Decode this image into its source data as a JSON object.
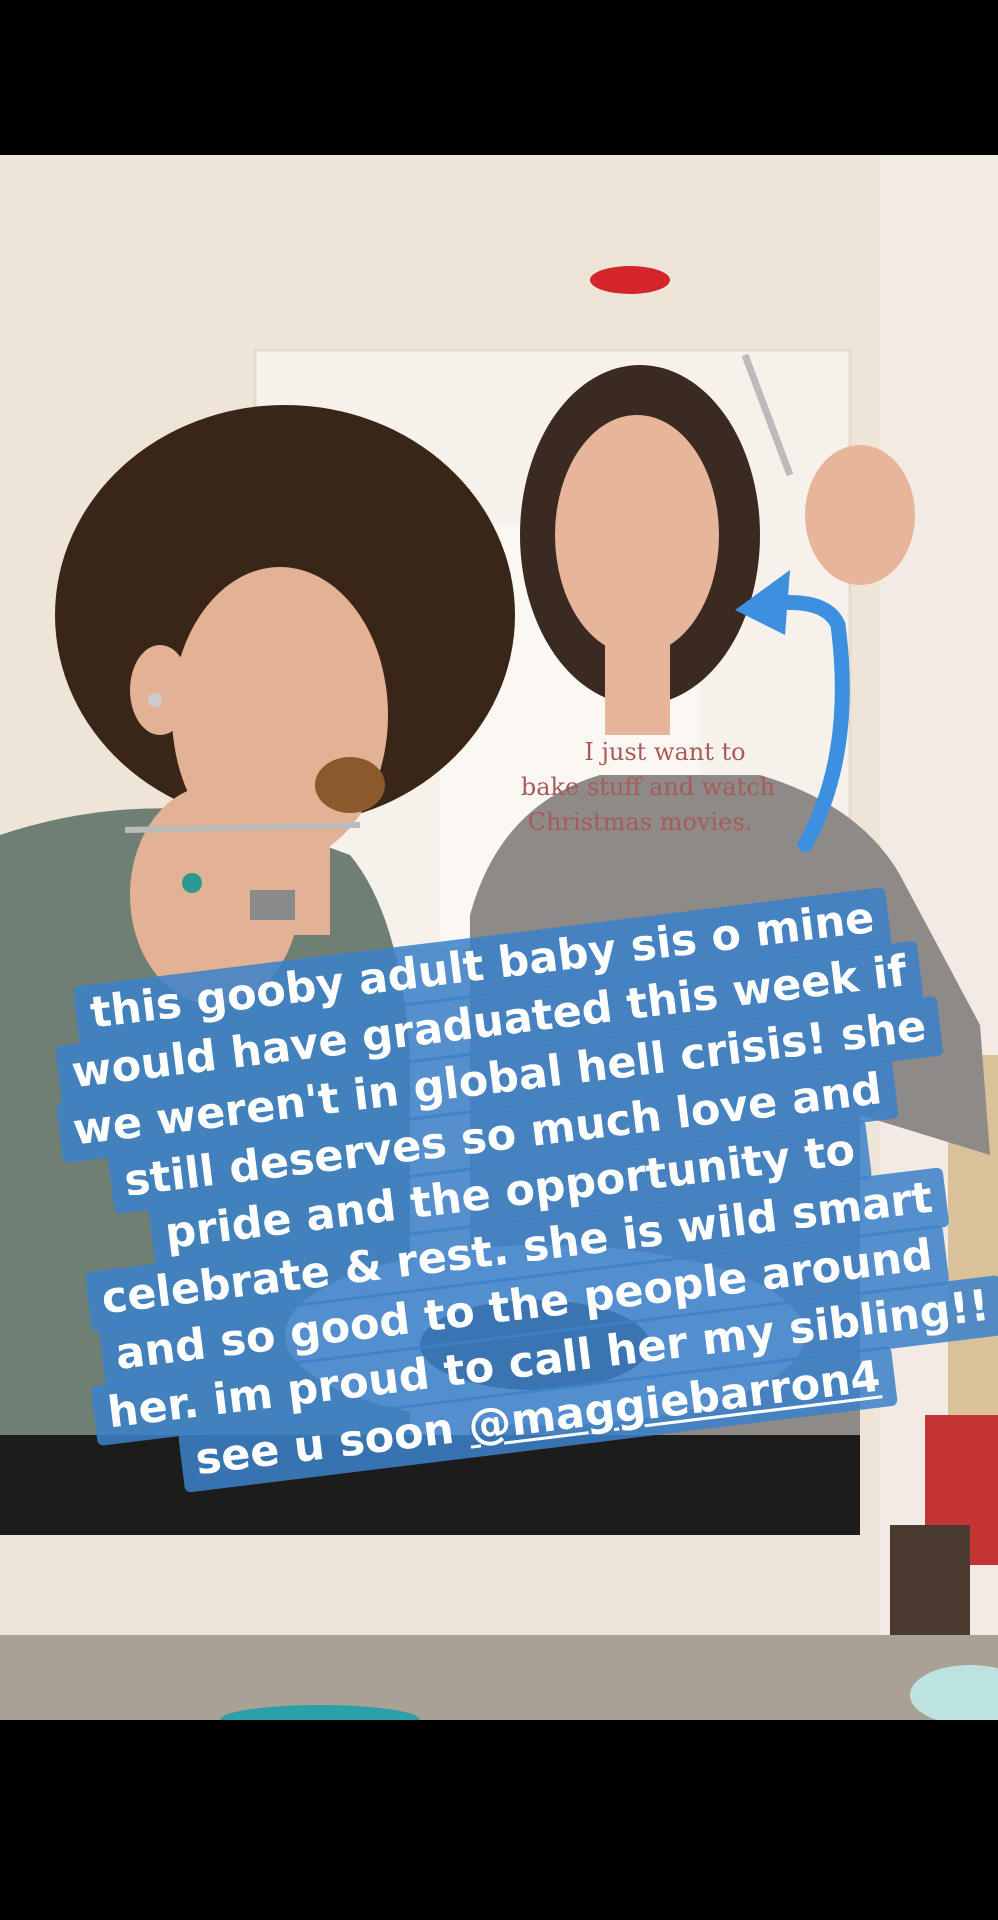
{
  "story": {
    "caption": {
      "lines": [
        "this gooby adult baby sis o mine",
        "would have graduated this week if",
        "we weren't in global hell crisis! she",
        "still deserves so much love and",
        "pride and the opportunity to",
        "celebrate & rest. she is wild smart",
        "and so good to the people around",
        "her. im proud to call her my sibling!!"
      ],
      "last_line_prefix": "see u soon ",
      "mention": "@maggiebarron4"
    },
    "shirt_text": [
      "I just want to",
      "bake stuff and watch",
      "Christmas movies."
    ],
    "colors": {
      "caption_bg": "#3b81c9",
      "arrow": "#3d8fe0",
      "shirt_text": "#a85a5a"
    }
  }
}
